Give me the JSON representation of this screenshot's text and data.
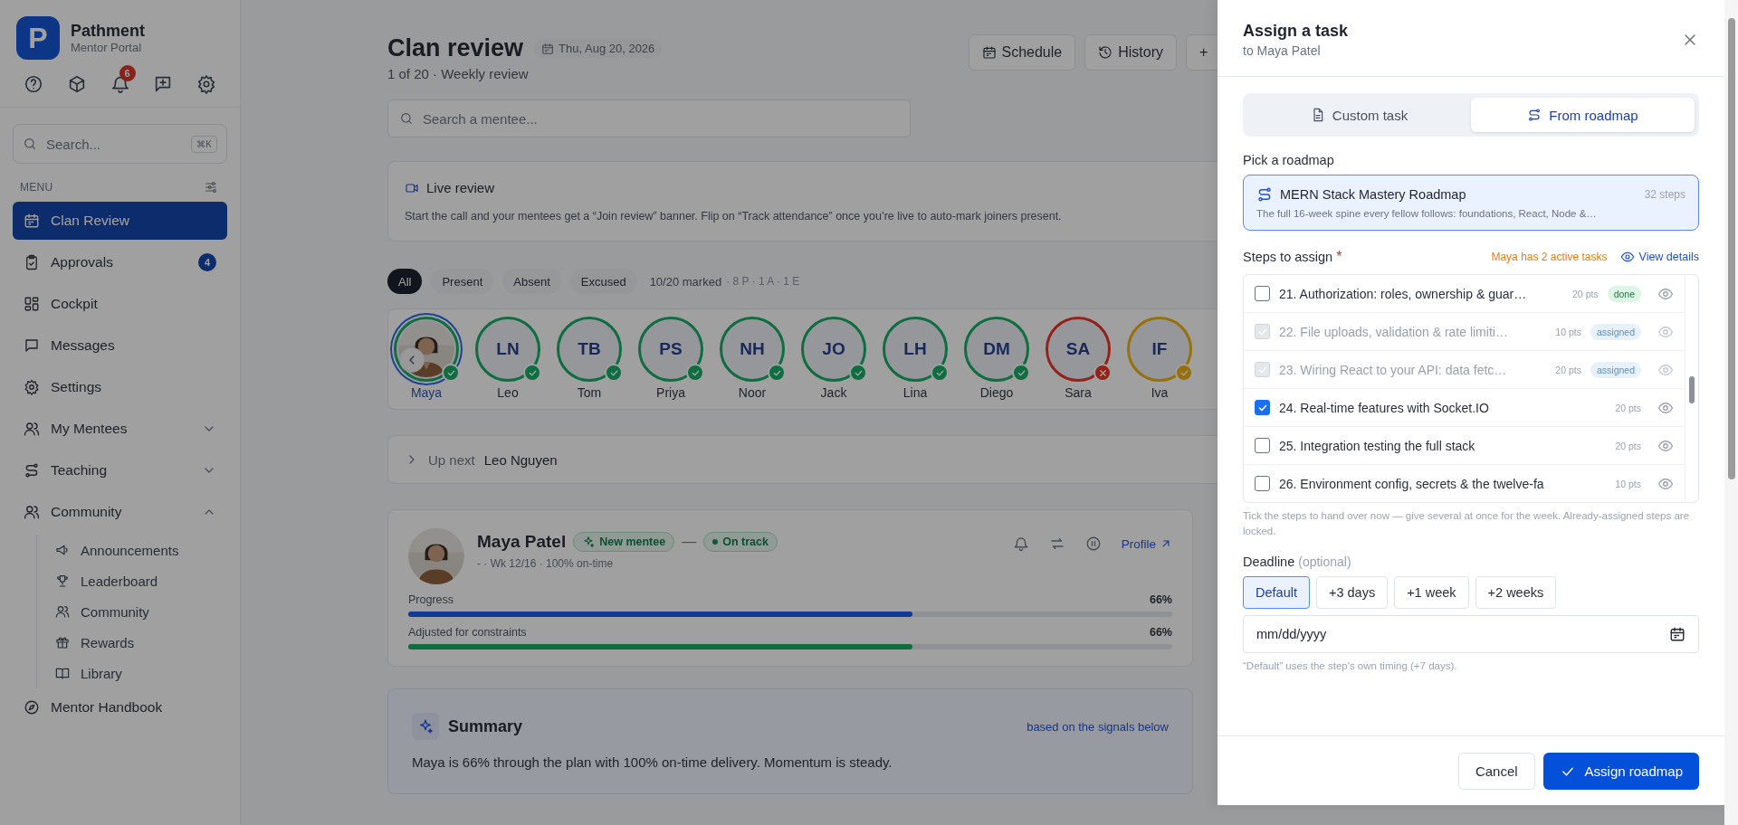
{
  "sidebar": {
    "brand": {
      "logo": "P",
      "name": "Pathment",
      "subtitle": "Mentor Portal"
    },
    "notifications": "6",
    "search": {
      "placeholder": "Search...",
      "shortcut": "⌘K"
    },
    "menu_label": "MENU",
    "items": [
      {
        "label": "Clan Review",
        "selected": true
      },
      {
        "label": "Approvals",
        "badge": "4",
        "selected": false
      },
      {
        "label": "Cockpit",
        "selected": false
      },
      {
        "label": "Messages",
        "selected": false
      },
      {
        "label": "Settings",
        "selected": false
      },
      {
        "label": "My Mentees",
        "selected": false,
        "expanded": false
      },
      {
        "label": "Teaching",
        "selected": false,
        "expanded": false
      },
      {
        "label": "Community",
        "selected": false,
        "expanded": true,
        "children": [
          {
            "label": "Announcements",
            "selected": false
          },
          {
            "label": "Leaderboard",
            "selected": false
          },
          {
            "label": "Community",
            "selected": false
          },
          {
            "label": "Rewards",
            "selected": false
          },
          {
            "label": "Library",
            "selected": false
          }
        ]
      },
      {
        "label": "Mentor Handbook",
        "selected": false
      }
    ]
  },
  "header": {
    "title": "Clan review",
    "date": "Thu, Aug 20, 2026",
    "subtitle": "1 of 20 · Weekly review",
    "actions": [
      "Schedule",
      "History",
      "+"
    ]
  },
  "search": {
    "placeholder": "Search a mentee..."
  },
  "live_review": {
    "title": "Live review",
    "text": "Start the call and your mentees get a “Join review” banner. Flip on “Track attendance” once you’re live to auto-mark joiners present."
  },
  "attendance": {
    "filters": [
      {
        "label": "All",
        "selected": true
      },
      {
        "label": "Present",
        "selected": false
      },
      {
        "label": "Absent",
        "selected": false
      },
      {
        "label": "Excused",
        "selected": false
      }
    ],
    "marked": "10/20 marked",
    "marked_detail": "· 8 P · 1 A · 1 E",
    "mentees": [
      {
        "name": "Maya",
        "color": "#08663a",
        "absent": false,
        "selected": true
      },
      {
        "kind": "initials",
        "initials": "LN",
        "name": "Leo",
        "color": "#08663a",
        "absent": false,
        "selected": false
      },
      {
        "kind": "initials",
        "initials": "TB",
        "name": "Tom",
        "color": "#08663a",
        "absent": false,
        "selected": false
      },
      {
        "kind": "initials",
        "initials": "PS",
        "name": "Priya",
        "color": "#08663a",
        "absent": false,
        "selected": false
      },
      {
        "kind": "initials",
        "initials": "NH",
        "name": "Noor",
        "color": "#08663a",
        "absent": false,
        "selected": false
      },
      {
        "kind": "initials",
        "initials": "JO",
        "name": "Jack",
        "color": "#08663a",
        "absent": false,
        "selected": false
      },
      {
        "kind": "initials",
        "initials": "LH",
        "name": "Lina",
        "color": "#08663a",
        "absent": false,
        "selected": false
      },
      {
        "kind": "initials",
        "initials": "DM",
        "name": "Diego",
        "color": "#08663a",
        "absent": false,
        "selected": false
      },
      {
        "kind": "initials",
        "initials": "SA",
        "name": "Sara",
        "color": "#8c1c14",
        "absent": true,
        "selected": false
      },
      {
        "kind": "initials",
        "initials": "IF",
        "name": "Iva",
        "color": "#8f6a05",
        "absent": false,
        "selected": false
      }
    ]
  },
  "up_next": {
    "label": "Up next",
    "name": "Leo Nguyen",
    "expanded": false
  },
  "mentee_card": {
    "name": "Maya Patel",
    "badges": [
      {
        "kind": "new",
        "label": "New mentee"
      },
      {
        "kind": "status",
        "label": "On track"
      }
    ],
    "separator": "—",
    "meta": "- · Wk 12/16 · 100% on-time",
    "profile": "Profile",
    "progress": [
      {
        "label": "Progress",
        "value": "66%",
        "level": 0.66,
        "color": "#0a3390"
      },
      {
        "label": "Adjusted for constraints",
        "value": "66%",
        "level": 0.66,
        "color": "#08663a"
      }
    ]
  },
  "summary": {
    "title": "Summary",
    "note": "based on the signals below",
    "text": "Maya is 66% through the plan with 100% on-time delivery. Momentum is steady."
  },
  "drawer": {
    "title": "Assign a task",
    "subtitle": "to Maya Patel",
    "tabs": [
      {
        "label": "Custom task",
        "selected": false
      },
      {
        "label": "From roadmap",
        "selected": true
      }
    ],
    "roadmap_label": "Pick a roadmap",
    "roadmap": {
      "title": "MERN Stack Mastery Roadmap",
      "steps": "32 steps",
      "description": "The full 16-week spine every fellow follows: foundations, React, Node &…",
      "selected": true
    },
    "steps_label": "Steps to assign",
    "required": "*",
    "active_note": "Maya has 2 active tasks",
    "view_details": "View details",
    "steps": [
      {
        "title": "21. Authorization: roles, ownership & guar…",
        "pts": "20 pts",
        "tag": {
          "kind": "done",
          "label": "done"
        },
        "checked": false,
        "disabled": false
      },
      {
        "title": "22. File uploads, validation & rate limiti…",
        "pts": "10 pts",
        "tag": {
          "kind": "assigned",
          "label": "assigned"
        },
        "checked": true,
        "disabled": true
      },
      {
        "title": "23. Wiring React to your API: data fetc…",
        "pts": "20 pts",
        "tag": {
          "kind": "assigned",
          "label": "assigned"
        },
        "checked": true,
        "disabled": true
      },
      {
        "title": "24. Real-time features with Socket.IO",
        "pts": "20 pts",
        "checked": true,
        "disabled": false
      },
      {
        "title": "25. Integration testing the full stack",
        "pts": "20 pts",
        "checked": false,
        "disabled": false
      },
      {
        "title": "26. Environment config, secrets & the twelve-fa",
        "pts": "10 pts",
        "checked": false,
        "disabled": false
      }
    ],
    "hint": "Tick the steps to hand over now — give several at once for the week. Already-assigned steps are locked.",
    "deadline_label": "Deadline",
    "deadline_optional": "(optional)",
    "deadline_options": [
      {
        "label": "Default",
        "selected": true
      },
      {
        "label": "+3 days",
        "selected": false
      },
      {
        "label": "+1 week",
        "selected": false
      },
      {
        "label": "+2 weeks",
        "selected": false
      }
    ],
    "date": {
      "placeholder": "mm/dd/yyyy"
    },
    "date_hint": "“Default” uses the step's own timing (+7 days).",
    "cancel": "Cancel",
    "submit": "Assign roadmap"
  }
}
